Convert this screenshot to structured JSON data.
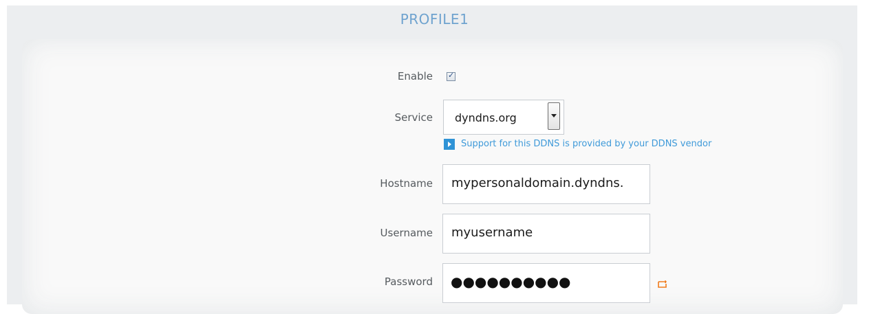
{
  "profile": {
    "title": "PROFILE1"
  },
  "form": {
    "enable": {
      "label": "Enable",
      "checked": true
    },
    "service": {
      "label": "Service",
      "value": "dyndns.org",
      "info_text": "Support for this DDNS is provided by your DDNS vendor"
    },
    "hostname": {
      "label": "Hostname",
      "value": "mypersonaldomain.dyndns."
    },
    "username": {
      "label": "Username",
      "value": "myusername"
    },
    "password": {
      "label": "Password",
      "masked_value": "●●●●●●●●●●"
    }
  },
  "icons": {
    "info": "info-arrow-icon",
    "dropdown": "chevron-down-icon",
    "reveal": "show-password-icon"
  },
  "colors": {
    "title": "#6fa3cf",
    "info_text": "#3f9ad9",
    "info_icon": "#2f93d6",
    "reveal_icon": "#f07a1a"
  }
}
